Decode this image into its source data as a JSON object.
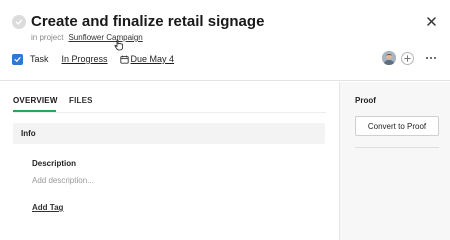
{
  "task": {
    "title": "Create and finalize retail signage",
    "project_prefix": "in project",
    "project_name": "Sunflower Campaign",
    "type_label": "Task",
    "status": "In Progress",
    "due": "Due May 4"
  },
  "tabs": [
    {
      "label": "OVERVIEW",
      "active": true
    },
    {
      "label": "FILES",
      "active": false
    }
  ],
  "overview": {
    "info_heading": "Info",
    "description_label": "Description",
    "description_placeholder": "Add description...",
    "add_tag_label": "Add Tag"
  },
  "side_panel": {
    "heading": "Proof",
    "convert_button": "Convert to Proof"
  },
  "colors": {
    "accent_green": "#26a85a",
    "task_icon_blue": "#2b78d6"
  },
  "icons": {
    "complete": "check-icon",
    "close": "close-icon",
    "task_type": "task-icon",
    "due_date": "calendar-icon",
    "add_member": "plus-icon",
    "more": "more-icon"
  }
}
